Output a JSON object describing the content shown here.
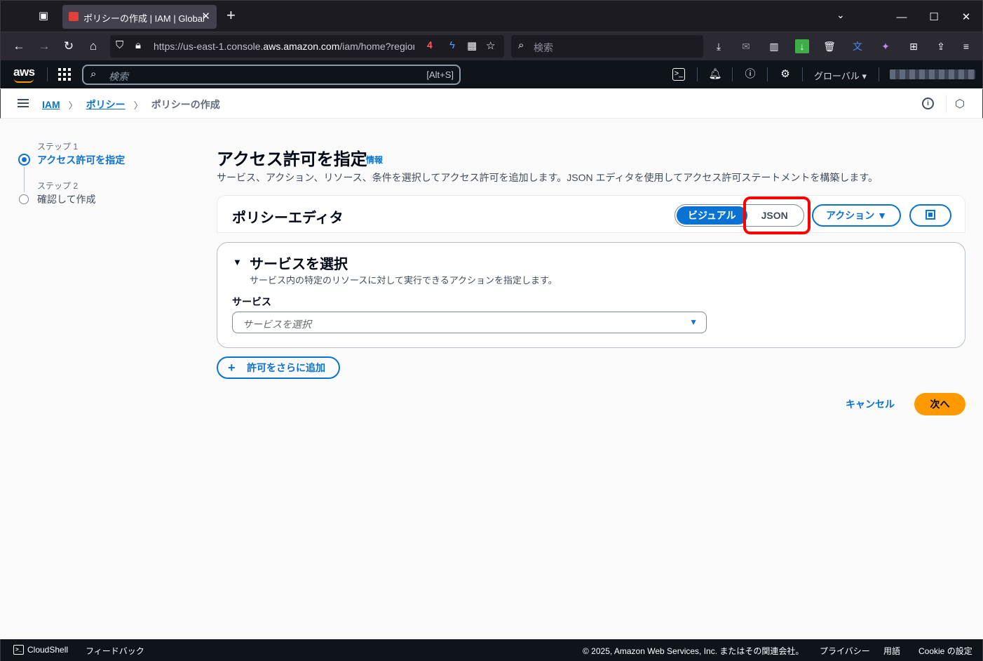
{
  "browser": {
    "tab_title": "ポリシーの作成 | IAM | Global",
    "url_prefix": "https://us-east-1.console.",
    "url_domain": "aws.amazon.com",
    "url_suffix": "/iam/home?region=",
    "web_search_placeholder": "検索"
  },
  "aws_nav": {
    "logo": "aws",
    "search_placeholder": "検索",
    "search_shortcut": "[Alt+S]",
    "region": "グローバル ▾"
  },
  "breadcrumb": {
    "items": [
      "IAM",
      "ポリシー"
    ],
    "current": "ポリシーの作成"
  },
  "steps": [
    {
      "label": "ステップ 1",
      "title": "アクセス許可を指定",
      "active": true
    },
    {
      "label": "ステップ 2",
      "title": "確認して作成",
      "active": false
    }
  ],
  "main": {
    "title": "アクセス許可を指定",
    "info": "情報",
    "description": "サービス、アクション、リソース、条件を選択してアクセス許可を追加します。JSON エディタを使用してアクセス許可ステートメントを構築します。",
    "editor_title": "ポリシーエディタ",
    "segment": {
      "visual": "ビジュアル",
      "json": "JSON",
      "selected": "ビジュアル"
    },
    "actions_button": "アクション ▼",
    "service_section": {
      "title": "サービスを選択",
      "description": "サービス内の特定のリソースに対して実行できるアクションを指定します。",
      "field_label": "サービス",
      "placeholder": "サービスを選択"
    },
    "add_permission": "許可をさらに追加",
    "cancel": "キャンセル",
    "next": "次へ"
  },
  "footer": {
    "cloudshell": "CloudShell",
    "feedback": "フィードバック",
    "copyright": "© 2025, Amazon Web Services, Inc. またはその関連会社。",
    "privacy": "プライバシー",
    "terms": "用語",
    "cookie": "Cookie の設定"
  },
  "colors": {
    "accent": "#0972d3",
    "primary_button": "#ff9900",
    "highlight": "#ff0000",
    "aws_nav_bg": "#0f141a"
  }
}
